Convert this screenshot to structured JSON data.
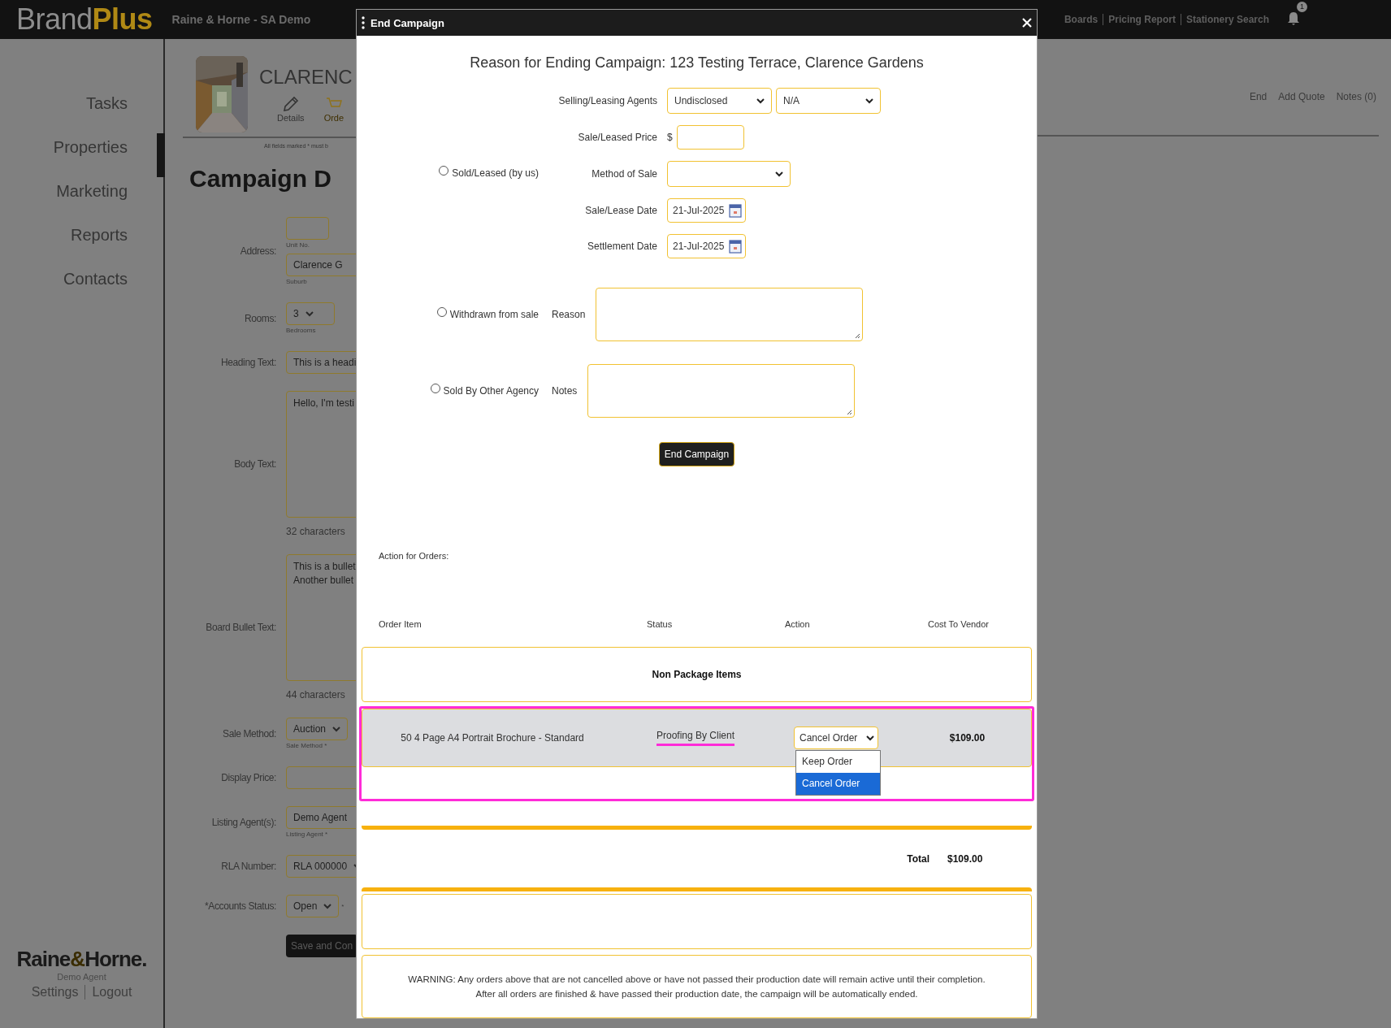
{
  "header": {
    "logo": [
      "Brand",
      "Plus"
    ],
    "office": "Raine & Horne - SA Demo",
    "links": [
      "Boards",
      "Pricing Report",
      "Stationery Search"
    ],
    "notification_count": "1"
  },
  "sidebar": {
    "items": [
      {
        "label": "Tasks",
        "selected": false
      },
      {
        "label": "Properties",
        "selected": true
      },
      {
        "label": "Marketing",
        "selected": false
      },
      {
        "label": "Reports",
        "selected": false
      },
      {
        "label": "Contacts",
        "selected": false
      }
    ],
    "brand": [
      "Raine",
      "&",
      "Horne."
    ],
    "user": "Demo Agent",
    "links": [
      "Settings",
      "Logout"
    ]
  },
  "property": {
    "title": "CLARENC",
    "tabs": [
      {
        "label": "Details",
        "selected": false
      },
      {
        "label": "Orde",
        "selected": true
      }
    ],
    "note": "All fields marked * must b",
    "actions": [
      "End",
      "Add Quote",
      "Notes (0)"
    ]
  },
  "campaign_form": {
    "title": "Campaign D",
    "fields": [
      {
        "label": "Address:",
        "controls": [
          {
            "kind": "input",
            "sublabel": "Unit No."
          },
          {
            "kind": "input",
            "value": "Clarence G",
            "sublabel": "Suburb"
          }
        ]
      },
      {
        "label": "Rooms:",
        "controls": [
          {
            "kind": "select",
            "value": "3",
            "sublabel": "Bedrooms"
          }
        ]
      },
      {
        "label": "Heading Text:",
        "controls": [
          {
            "kind": "input",
            "value": "This is a headi"
          }
        ]
      },
      {
        "label": "Body Text:",
        "controls": [
          {
            "kind": "textarea",
            "value": "Hello, I'm testi",
            "note": "32 characters"
          }
        ]
      },
      {
        "label": "Board Bullet Text:",
        "controls": [
          {
            "kind": "textarea",
            "value": "This is a bullet\nAnother bullet",
            "note": "44 characters"
          }
        ]
      },
      {
        "label": "Sale Method:",
        "controls": [
          {
            "kind": "select",
            "value": "Auction",
            "sublabel": "Sale Method *"
          }
        ]
      },
      {
        "label": "Display Price:",
        "controls": [
          {
            "kind": "input"
          }
        ]
      },
      {
        "label": "Listing Agent(s):",
        "controls": [
          {
            "kind": "input",
            "value": "Demo Agent",
            "sublabel": "Listing Agent *"
          }
        ]
      },
      {
        "label": "RLA Number:",
        "controls": [
          {
            "kind": "select",
            "value": "RLA 000000"
          }
        ]
      },
      {
        "label": "*Accounts Status:",
        "controls": [
          {
            "kind": "select",
            "value": "Open",
            "suffix": "*"
          }
        ]
      }
    ],
    "button": "Save and Con"
  },
  "modal": {
    "title": "End Campaign",
    "heading": "Reason for Ending Campaign: 123 Testing Terrace, Clarence Gardens",
    "options": [
      {
        "label": "Sold/Leased (by us)",
        "selected": false,
        "fields": [
          {
            "label": "Selling/Leasing Agents",
            "kind": "selects",
            "values": [
              "Undisclosed",
              "N/A"
            ]
          },
          {
            "label": "Sale/Leased Price",
            "kind": "price",
            "prefix": "$"
          },
          {
            "label": "Method of Sale",
            "kind": "select"
          },
          {
            "label": "Sale/Lease Date",
            "kind": "date",
            "value": "21-Jul-2025"
          },
          {
            "label": "Settlement Date",
            "kind": "date",
            "value": "21-Jul-2025"
          }
        ]
      },
      {
        "label": "Withdrawn from sale",
        "selected": false,
        "fields": [
          {
            "label": "Reason",
            "kind": "textarea"
          }
        ]
      },
      {
        "label": "Sold By Other Agency",
        "selected": false,
        "fields": [
          {
            "label": "Notes",
            "kind": "textarea"
          }
        ]
      }
    ],
    "submit": "End Campaign",
    "orders": {
      "caption": "Action for Orders:",
      "columns": [
        "Order Item",
        "Status",
        "Action",
        "Cost To Vendor"
      ],
      "group": "Non Package Items",
      "rows": [
        {
          "item": "50 4 Page A4 Portrait Brochure - Standard",
          "status": "Proofing By Client",
          "action": "Cancel Order",
          "cost": "$109.00",
          "highlighted": true,
          "dropdown": {
            "open": true,
            "options": [
              {
                "label": "Keep Order",
                "selected": false
              },
              {
                "label": "Cancel Order",
                "selected": true
              }
            ]
          }
        }
      ],
      "total_label": "Total",
      "total": "$109.00"
    },
    "warning": "WARNING: Any orders above that are not cancelled above or have not passed their production date will remain active until their completion.\nAfter all orders are finished & have passed their production date, the campaign will be automatically ended."
  }
}
